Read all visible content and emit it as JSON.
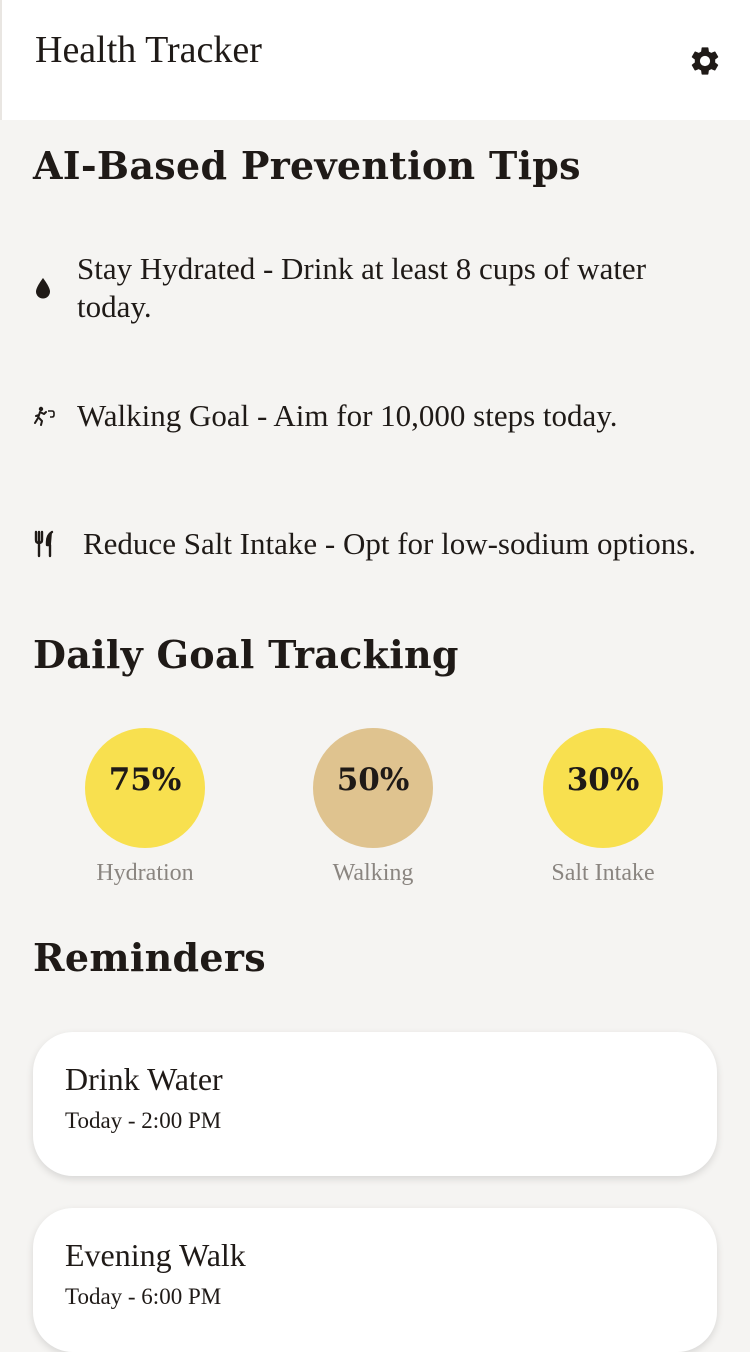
{
  "header": {
    "title": "Health Tracker",
    "settings_icon": "gear-icon"
  },
  "tips_section": {
    "title": "AI-Based Prevention Tips",
    "items": [
      {
        "icon": "water-drop-icon",
        "text": "Stay Hydrated - Drink at least 8 cups of water today."
      },
      {
        "icon": "walking-icon",
        "text": "Walking Goal - Aim for 10,000 steps today."
      },
      {
        "icon": "fork-knife-icon",
        "text": "Reduce Salt Intake - Opt for low-sodium options."
      }
    ]
  },
  "goals_section": {
    "title": "Daily Goal Tracking",
    "goals": [
      {
        "value": "75%",
        "label": "Hydration",
        "color": "#f8e04f"
      },
      {
        "value": "50%",
        "label": "Walking",
        "color": "#dfc38f"
      },
      {
        "value": "30%",
        "label": "Salt Intake",
        "color": "#f8e04f"
      }
    ]
  },
  "reminders_section": {
    "title": "Reminders",
    "items": [
      {
        "title": "Drink Water",
        "time": "Today - 2:00 PM"
      },
      {
        "title": "Evening Walk",
        "time": "Today - 6:00 PM"
      }
    ]
  },
  "colors": {
    "background": "#f5f4f2",
    "card": "#ffffff",
    "text": "#1f1a17",
    "muted": "#8a8580"
  }
}
